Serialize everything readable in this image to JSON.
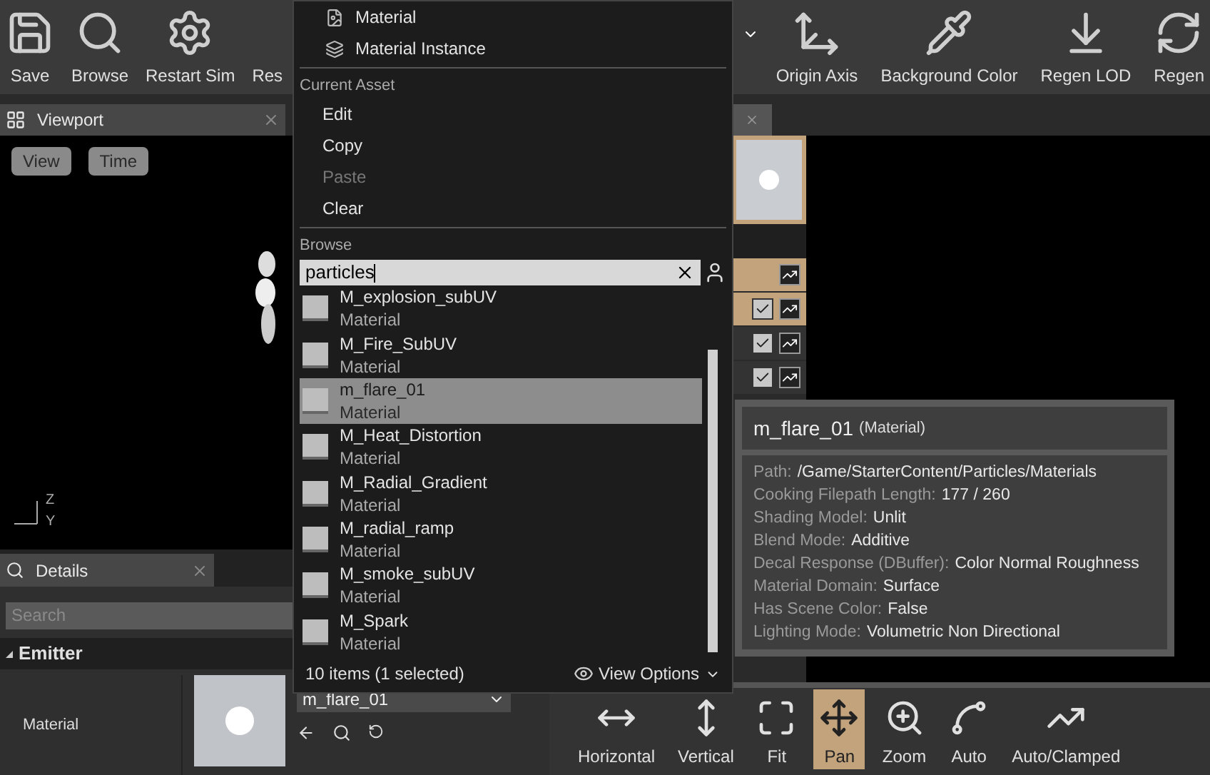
{
  "toolbar": {
    "left": [
      {
        "label": "Save"
      },
      {
        "label": "Browse"
      },
      {
        "label": "Restart Sim"
      },
      {
        "label": "Res"
      }
    ],
    "right": [
      {
        "label": "Origin Axis"
      },
      {
        "label": "Background Color"
      },
      {
        "label": "Regen LOD"
      },
      {
        "label": "Regen"
      }
    ]
  },
  "viewport": {
    "tab": "Viewport",
    "buttons": [
      "View",
      "Time"
    ],
    "axis_labels": [
      "Z",
      "Y"
    ]
  },
  "details": {
    "tab": "Details",
    "search": {
      "placeholder": "Search"
    },
    "section": {
      "label": "Emitter",
      "expanded": true
    },
    "property": {
      "label": "Material",
      "value": "m_flare_01"
    }
  },
  "emitter_column": {
    "header_row": {
      "selected": true
    },
    "rows": [
      {
        "selected": true,
        "checked": true
      },
      {
        "selected": false,
        "checked": true
      },
      {
        "selected": false,
        "checked": true
      }
    ]
  },
  "curve_toolbar": [
    {
      "label": "Horizontal",
      "selected": false
    },
    {
      "label": "Vertical",
      "selected": false
    },
    {
      "label": "Fit",
      "selected": false
    },
    {
      "label": "Pan",
      "selected": true
    },
    {
      "label": "Zoom",
      "selected": false
    },
    {
      "label": "Auto",
      "selected": false
    },
    {
      "label": "Auto/Clamped",
      "selected": false
    }
  ],
  "menu": {
    "create_items": [
      "Material",
      "Material Instance"
    ],
    "current_asset": {
      "heading": "Current Asset",
      "actions": [
        {
          "label": "Edit",
          "disabled": false
        },
        {
          "label": "Copy",
          "disabled": false
        },
        {
          "label": "Paste",
          "disabled": true
        },
        {
          "label": "Clear",
          "disabled": false
        }
      ]
    },
    "browse": {
      "heading": "Browse",
      "search_value": "particles",
      "items": [
        {
          "name": "M_explosion_subUV",
          "type": "Material",
          "selected": false
        },
        {
          "name": "M_Fire_SubUV",
          "type": "Material",
          "selected": false
        },
        {
          "name": "m_flare_01",
          "type": "Material",
          "selected": true
        },
        {
          "name": "M_Heat_Distortion",
          "type": "Material",
          "selected": false
        },
        {
          "name": "M_Radial_Gradient",
          "type": "Material",
          "selected": false
        },
        {
          "name": "M_radial_ramp",
          "type": "Material",
          "selected": false
        },
        {
          "name": "M_smoke_subUV",
          "type": "Material",
          "selected": false
        },
        {
          "name": "M_Spark",
          "type": "Material",
          "selected": false
        }
      ],
      "count": "10 items (1 selected)",
      "view_options": "View Options"
    }
  },
  "tooltip": {
    "name": "m_flare_01",
    "type": "(Material)",
    "fields": [
      {
        "label": "Path:",
        "value": "/Game/StarterContent/Particles/Materials"
      },
      {
        "label": "Cooking Filepath Length:",
        "value": "177 / 260"
      },
      {
        "label": "Shading Model:",
        "value": "Unlit"
      },
      {
        "label": "Blend Mode:",
        "value": "Additive"
      },
      {
        "label": "Decal Response (DBuffer):",
        "value": "Color Normal Roughness"
      },
      {
        "label": "Material Domain:",
        "value": "Surface"
      },
      {
        "label": "Has Scene Color:",
        "value": "False"
      },
      {
        "label": "Lighting Mode:",
        "value": "Volumetric Non Directional"
      }
    ]
  }
}
